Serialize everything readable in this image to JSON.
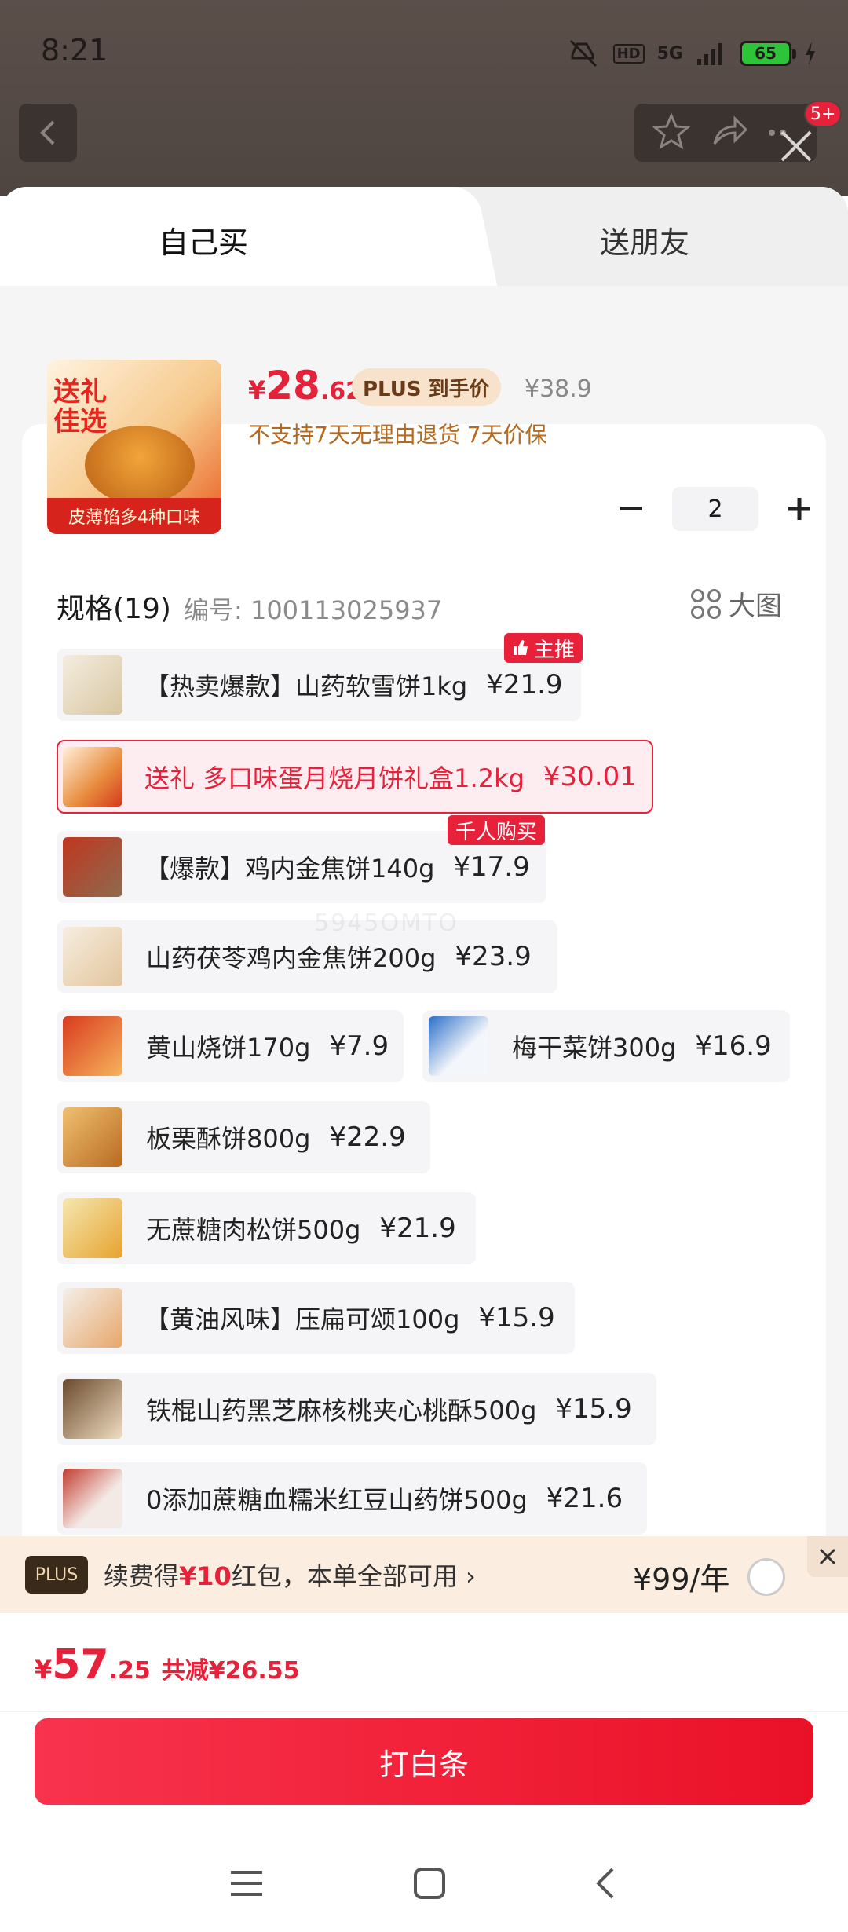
{
  "status": {
    "time": "8:21",
    "network": "5G",
    "hd": "HD",
    "battery": "65"
  },
  "header": {
    "badge": "5+"
  },
  "tabs": [
    {
      "label": "自己买"
    },
    {
      "label": "送朋友"
    }
  ],
  "product": {
    "image_text_top": "送礼佳选",
    "image_text_bottom": "皮薄馅多4种口味",
    "price_currency": "¥",
    "price_int": "28",
    "price_dec": ".62",
    "plus_tag": "PLUS 到手价",
    "original_price": "¥38.9",
    "return_note": "不支持7天无理由退货  7天价保",
    "quantity": "2"
  },
  "spec": {
    "title": "规格(19)",
    "number": "编号: 100113025937",
    "big_image": "大图"
  },
  "options": [
    {
      "name": "【热卖爆款】山药软雪饼1kg",
      "price": "¥21.9",
      "tag": "主推"
    },
    {
      "name": "送礼 多口味蛋月烧月饼礼盒1.2kg",
      "price": "¥30.01"
    },
    {
      "name": "【爆款】鸡内金焦饼140g",
      "price": "¥17.9",
      "tag": "千人购买"
    },
    {
      "name": "山药茯苓鸡内金焦饼200g",
      "price": "¥23.9"
    },
    {
      "name": "黄山烧饼170g",
      "price": "¥7.9"
    },
    {
      "name": "梅干菜饼300g",
      "price": "¥16.9"
    },
    {
      "name": "板栗酥饼800g",
      "price": "¥22.9"
    },
    {
      "name": "无蔗糖肉松饼500g",
      "price": "¥21.9"
    },
    {
      "name": "【黄油风味】压扁可颂100g",
      "price": "¥15.9"
    },
    {
      "name": "铁棍山药黑芝麻核桃夹心桃酥500g",
      "price": "¥15.9"
    },
    {
      "name": "0添加蔗糖血糯米红豆山药饼500g",
      "price": "¥21.6"
    }
  ],
  "watermark": "5945OMTO",
  "plus_bar": {
    "logo": "PLUS",
    "text_a": "续费得",
    "text_hl": "¥10",
    "text_b": "红包，本单全部可用 ›",
    "price": "¥99/年"
  },
  "bottom": {
    "currency": "¥",
    "total_int": "57",
    "total_dec": ".25",
    "savings": "共减¥26.55",
    "pay_label": "打白条"
  },
  "colors": {
    "accent": "#e8213a",
    "plus_bg": "#fbeee0"
  }
}
